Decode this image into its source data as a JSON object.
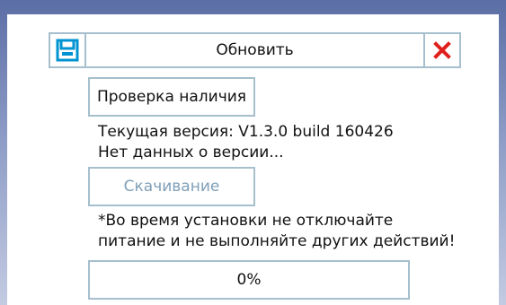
{
  "dialog": {
    "title": "Обновить",
    "icons": {
      "left": "save-icon",
      "right": "close-icon"
    },
    "colors": {
      "border": "#a6bfcd",
      "save_icon": "#0093d1",
      "close_icon": "#e0201c"
    }
  },
  "check_button": {
    "label": "Проверка наличия"
  },
  "version": {
    "current": "Текущая версия: V1.3.0 build 160426",
    "status": "Нет данных о версии..."
  },
  "download_button": {
    "label": "Скачивание",
    "enabled": false
  },
  "warning": {
    "line1": "*Во время установки не отключайте",
    "line2": "питание и не выполняйте других действий!"
  },
  "progress": {
    "value": 0,
    "label": "0%"
  }
}
